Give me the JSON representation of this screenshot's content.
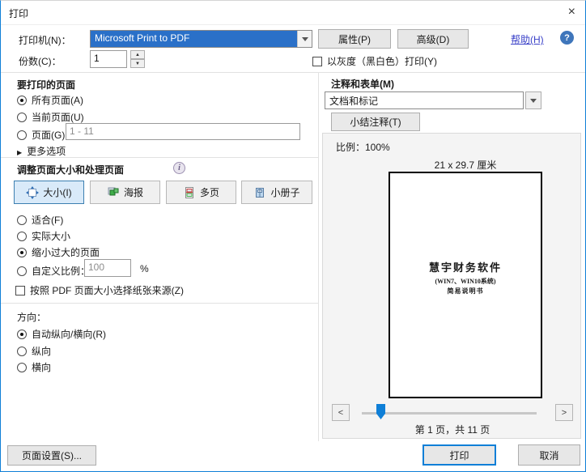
{
  "window": {
    "title": "打印"
  },
  "icons": {
    "close": "×",
    "help": "?",
    "info": "i",
    "spin_up": "▲",
    "spin_down": "▼",
    "more_arrow": "▶"
  },
  "printer": {
    "label": "打印机(N)：",
    "value": "Microsoft Print to PDF",
    "properties_button": "属性(P)",
    "advanced_button": "高级(D)",
    "help_link": "帮助(H)",
    "copies_label": "份数(C)：",
    "copies_value": "1",
    "grayscale_checkbox": "以灰度（黑白色）打印(Y)"
  },
  "pages_section": {
    "title": "要打印的页面",
    "items": [
      {
        "label": "所有页面(A)",
        "selected": true
      },
      {
        "label": "当前页面(U)",
        "selected": false
      },
      {
        "label": "页面(G)",
        "selected": false
      }
    ],
    "range_value": "1 - 11",
    "more_options": "更多选项"
  },
  "sizing_section": {
    "title": "调整页面大小和处理页面",
    "buttons": [
      {
        "label": "大小(I)",
        "icon": "size-icon",
        "selected": true
      },
      {
        "label": "海报",
        "icon": "poster-icon",
        "selected": false
      },
      {
        "label": "多页",
        "icon": "multiple-pages-icon",
        "selected": false
      },
      {
        "label": "小册子",
        "icon": "booklet-icon",
        "selected": false
      }
    ],
    "items": [
      {
        "label": "适合(F)",
        "selected": false
      },
      {
        "label": "实际大小",
        "selected": false
      },
      {
        "label": "缩小过大的页面",
        "selected": true
      },
      {
        "label": "自定义比例：",
        "selected": false
      }
    ],
    "custom_scale_value": "100",
    "percent_label": "%",
    "paper_source_checkbox": "按照 PDF 页面大小选择纸张来源(Z)"
  },
  "orientation_section": {
    "title": "方向：",
    "items": [
      {
        "label": "自动纵向/横向(R)",
        "selected": true
      },
      {
        "label": "纵向",
        "selected": false
      },
      {
        "label": "横向",
        "selected": false
      }
    ]
  },
  "comments_section": {
    "title": "注释和表单(M)",
    "dropdown_value": "文档和标记",
    "summarize_button": "小结注释(T)"
  },
  "preview": {
    "scale_label": "比例：100%",
    "paper_size": "21 x 29.7 厘米",
    "page_title": "慧宇财务软件",
    "page_subtitle1": "(WIN7、WIN10系统)",
    "page_subtitle2": "简易说明书",
    "page_status": "第 1 页，共 11 页",
    "prev": "<",
    "next": ">"
  },
  "footer": {
    "page_setup_button": "页面设置(S)...",
    "print_button": "打印",
    "cancel_button": "取消"
  },
  "colors": {
    "accent": "#0f7fd7",
    "selection": "#2a70c8",
    "selected_tool_bg": "#d9eaf9"
  }
}
